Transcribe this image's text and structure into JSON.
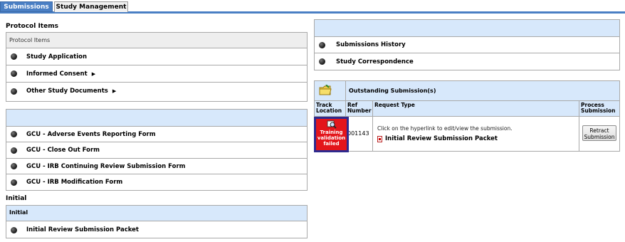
{
  "tabs": [
    {
      "label": "Submissions"
    },
    {
      "label": "Study Management"
    }
  ],
  "protocol": {
    "section_title": "Protocol Items",
    "header": "Protocol Items",
    "items": [
      {
        "label": "Study Application"
      },
      {
        "label": "Informed Consent",
        "has_submenu": true
      },
      {
        "label": "Other Study Documents",
        "has_submenu": true
      }
    ]
  },
  "forms": {
    "items": [
      {
        "label": "GCU - Adverse Events Reporting Form"
      },
      {
        "label": "GCU - Close Out Form"
      },
      {
        "label": "GCU - IRB Continuing Review Submission Form"
      },
      {
        "label": "GCU - IRB Modification Form"
      }
    ]
  },
  "initial": {
    "section_title": "Initial",
    "header": "Initial",
    "items": [
      {
        "label": "Initial Review Submission Packet"
      }
    ]
  },
  "history": {
    "items": [
      {
        "label": "Submissions History"
      },
      {
        "label": "Study Correspondence"
      }
    ]
  },
  "outstanding": {
    "title": "Outstanding Submission(s)",
    "columns": {
      "track": "Track Location",
      "ref": "Ref Number",
      "request": "Request Type",
      "process": "Process Submission"
    },
    "row": {
      "track_status": "Training validation failed",
      "ref_number": "001143",
      "hint": "Click on the hyperlink to edit/view the submission.",
      "request_link": "Initial Review Submission Packet",
      "action_label": "Retract Submission"
    }
  },
  "colors": {
    "accent": "#4a7fc4",
    "panel_header": "#d7e8fb",
    "track_fail": "#e3151b",
    "track_border": "#2e2a8e"
  }
}
